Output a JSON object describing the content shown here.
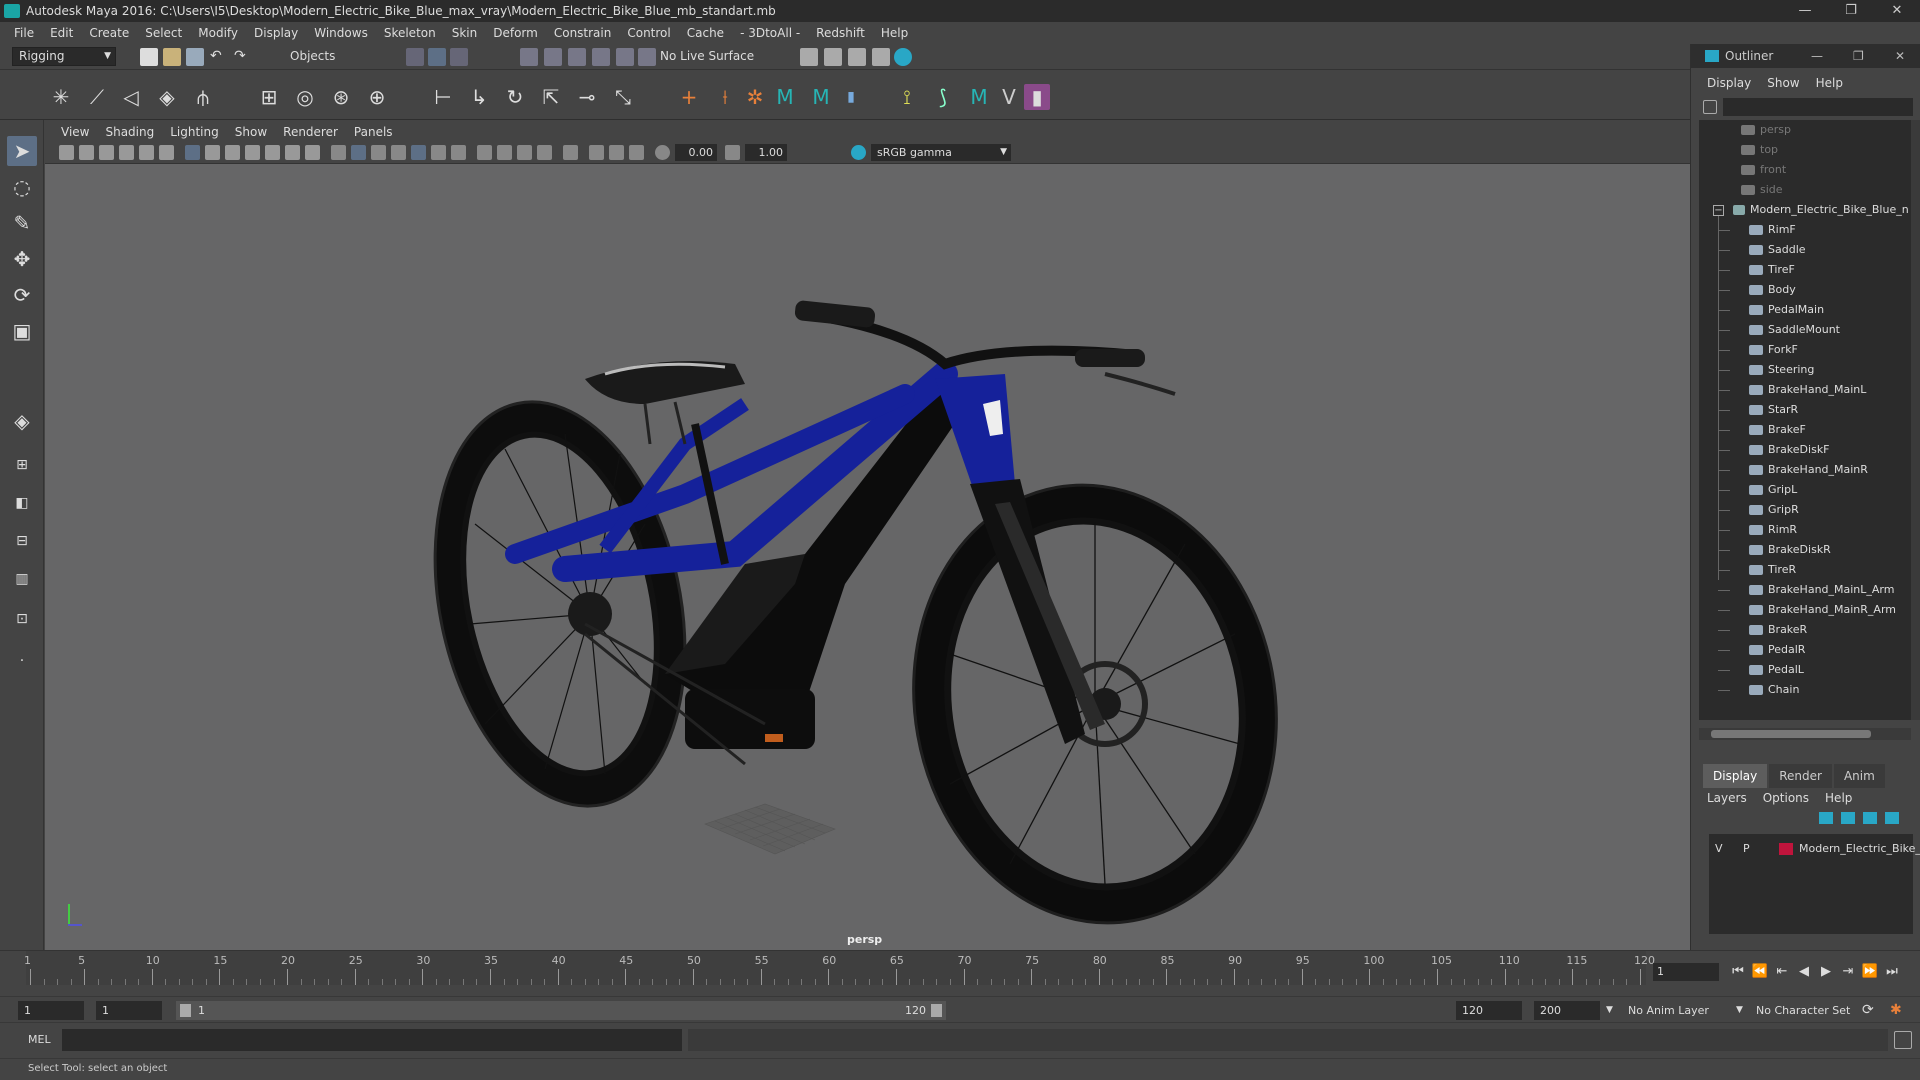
{
  "window": {
    "title": "Autodesk Maya 2016: C:\\Users\\I5\\Desktop\\Modern_Electric_Bike_Blue_max_vray\\Modern_Electric_Bike_Blue_mb_standart.mb",
    "minimize": "—",
    "maximize": "❐",
    "close": "✕"
  },
  "menu": [
    "File",
    "Edit",
    "Create",
    "Select",
    "Modify",
    "Display",
    "Windows",
    "Skeleton",
    "Skin",
    "Deform",
    "Constrain",
    "Control",
    "Cache",
    "- 3DtoAll -",
    "Redshift",
    "Help"
  ],
  "toolbar": {
    "mode": "Rigging",
    "objects": "Objects",
    "live_surface": "No Live Surface"
  },
  "viewport": {
    "menu": [
      "View",
      "Shading",
      "Lighting",
      "Show",
      "Renderer",
      "Panels"
    ],
    "exposure": "0.00",
    "gamma": "1.00",
    "color_space": "sRGB gamma",
    "camera_label": "persp"
  },
  "outliner": {
    "title": "Outliner",
    "menu": [
      "Display",
      "Show",
      "Help"
    ],
    "cameras": [
      "persp",
      "top",
      "front",
      "side"
    ],
    "root": "Modern_Electric_Bike_Blue_n",
    "children": [
      "RimF",
      "Saddle",
      "TireF",
      "Body",
      "PedalMain",
      "SaddleMount",
      "ForkF",
      "Steering",
      "BrakeHand_MainL",
      "StarR",
      "BrakeF",
      "BrakeDiskF",
      "BrakeHand_MainR",
      "GripL",
      "GripR",
      "RimR",
      "BrakeDiskR",
      "TireR",
      "BrakeHand_MainL_Arm",
      "BrakeHand_MainR_Arm",
      "BrakeR",
      "PedalR",
      "PedalL",
      "Chain"
    ]
  },
  "layer_editor": {
    "tabs": [
      "Display",
      "Render",
      "Anim"
    ],
    "menu": [
      "Layers",
      "Options",
      "Help"
    ],
    "layer": {
      "v": "V",
      "p": "P",
      "name": "Modern_Electric_Bike_",
      "color": "#c0143c"
    }
  },
  "timeline": {
    "ticks": [
      1,
      5,
      10,
      15,
      20,
      25,
      30,
      35,
      40,
      45,
      50,
      55,
      60,
      65,
      70,
      75,
      80,
      85,
      90,
      95,
      100,
      105,
      110,
      115,
      120
    ],
    "current_frame": "1"
  },
  "range": {
    "start": "1",
    "playback_start": "1",
    "slider_start": "1",
    "slider_end": "120",
    "playback_end": "120",
    "end": "200",
    "anim_layer": "No Anim Layer",
    "character_set": "No Character Set"
  },
  "command": {
    "label": "MEL"
  },
  "help_line": "Select Tool: select an object",
  "colors": {
    "accent": "#5d6f86",
    "maya_teal": "#26b5b5",
    "bike_blue": "#15219a"
  }
}
